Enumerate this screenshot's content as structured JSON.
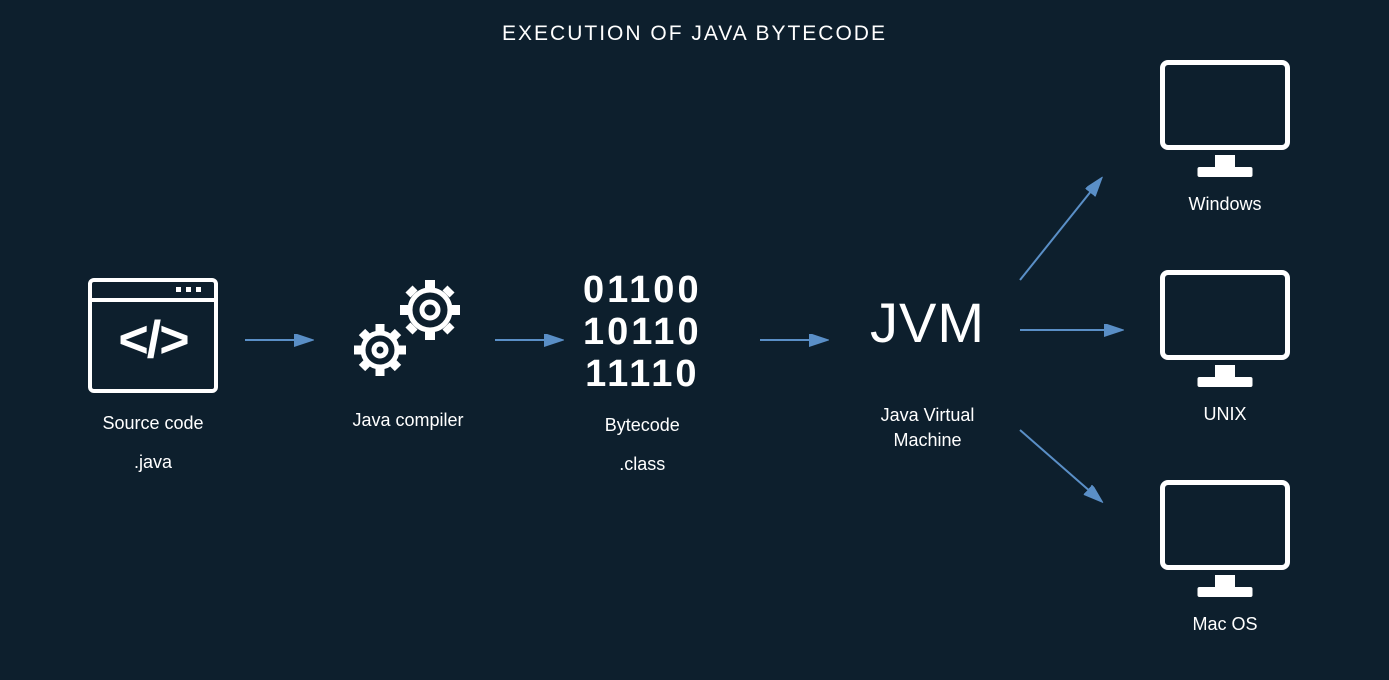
{
  "title": "EXECUTION OF JAVA BYTECODE",
  "nodes": {
    "source": {
      "label1": "Source code",
      "label2": ".java",
      "code_glyph": "</>"
    },
    "compiler": {
      "label1": "Java compiler"
    },
    "bytecode": {
      "label1": "Bytecode",
      "label2": ".class",
      "bits": [
        "01100",
        "10110",
        "11110"
      ]
    },
    "jvm": {
      "text": "JVM",
      "label1": "Java Virtual",
      "label2": "Machine"
    },
    "windows": {
      "label": "Windows"
    },
    "unix": {
      "label": "UNIX"
    },
    "macos": {
      "label": "Mac OS"
    }
  },
  "arrows": [
    "source-to-compiler",
    "compiler-to-bytecode",
    "bytecode-to-jvm",
    "jvm-to-windows",
    "jvm-to-unix",
    "jvm-to-macos"
  ]
}
